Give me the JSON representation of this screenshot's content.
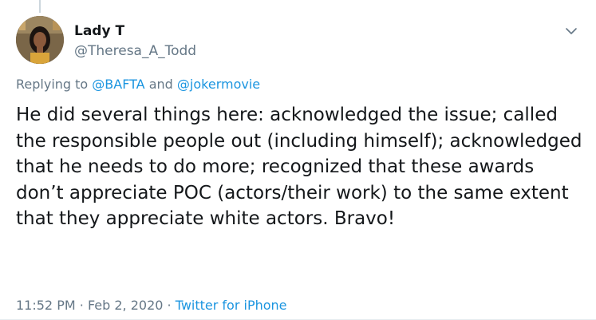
{
  "user": {
    "display_name": "Lady T",
    "handle": "@Theresa_A_Todd"
  },
  "reply_context": {
    "prefix": "Replying to",
    "mention1": "@BAFTA",
    "conjunction": "and",
    "mention2": "@jokermovie"
  },
  "tweet": {
    "text": "He did several things here: acknowledged the issue; called the responsible people out (including himself); acknowledged that he needs to do more; recognized that these awards don’t appreciate POC (actors/their work) to the same extent that they appreciate white actors. Bravo!"
  },
  "meta": {
    "time": "11:52 PM",
    "separator1": "·",
    "date": "Feb 2, 2020",
    "separator2": "·",
    "source": "Twitter for iPhone"
  },
  "icons": {
    "menu": "chevron-down-icon",
    "avatar": "profile-photo"
  },
  "colors": {
    "link": "#1b95e0",
    "secondary_text": "#657786",
    "primary_text": "#14171a"
  }
}
